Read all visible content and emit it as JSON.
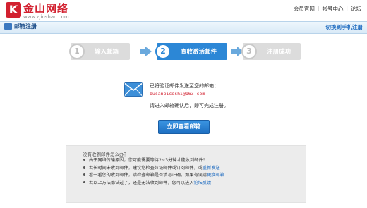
{
  "header": {
    "logo_k": "K",
    "logo_name": "金山网络",
    "logo_url": "www.zjinshan.com",
    "nav": [
      "会员官网",
      "帐号中心",
      "论坛"
    ]
  },
  "bar": {
    "title": "邮箱注册",
    "switch_link": "切换到手机注册"
  },
  "steps": [
    {
      "num": "1",
      "label": "输入邮箱"
    },
    {
      "num": "2",
      "label": "查收激活邮件"
    },
    {
      "num": "3",
      "label": "注册成功"
    }
  ],
  "message": {
    "sent": "已将验证邮件发送至您的邮箱：",
    "email": "busanpiceshi@163.com",
    "instruction": "请进入邮箱确认后，即可完成注册。"
  },
  "button": {
    "check_mail": "立即查看邮箱"
  },
  "help": {
    "title": "没有收到邮件怎么办？",
    "items": [
      {
        "text": "由于网络传输原因，您可能需要等待2~3分钟才能收到邮件！",
        "link": ""
      },
      {
        "text": "若长时间未收到邮件，建议您检查垃圾邮件或订阅邮件，或",
        "link": "重新发送"
      },
      {
        "text": "看一看您的收到邮件，请检查邮箱是否填写正确，如果有误请",
        "link": "更换邮箱"
      },
      {
        "text": "若以上方法都试过了，还是无法收到邮件，您可以进入",
        "link": "论坛反馈"
      }
    ]
  },
  "colors": {
    "brand": "#d2202f",
    "accent": "#2c87d6",
    "link": "#1e6bc0"
  }
}
